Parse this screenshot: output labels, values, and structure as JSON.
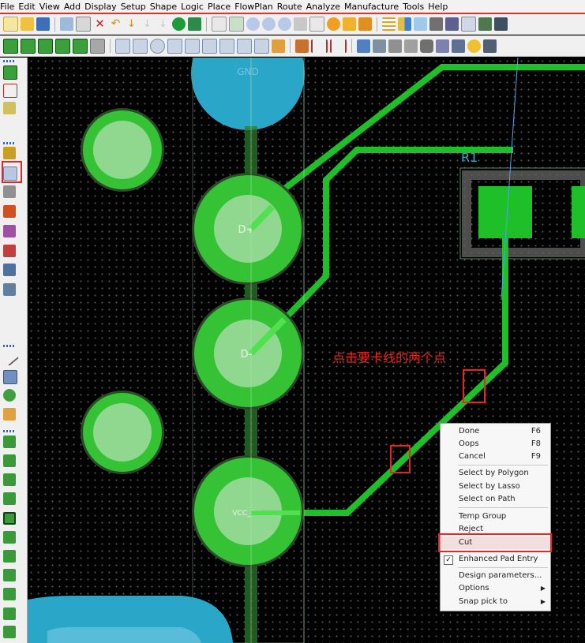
{
  "menu": [
    "File",
    "Edit",
    "View",
    "Add",
    "Display",
    "Setup",
    "Shape",
    "Logic",
    "Place",
    "FlowPlan",
    "Route",
    "Analyze",
    "Manufacture",
    "Tools",
    "Help"
  ],
  "canvas": {
    "pad_labels": {
      "gnd": "GND",
      "dplus": "D+",
      "dminus": "D-",
      "vcc": "VCC_5V"
    },
    "component_ref": "R1",
    "trace_labels": [
      "D+",
      "D-",
      "VCC_5V"
    ]
  },
  "annotation": "点击要卡线的两个点",
  "context_menu": {
    "groups": [
      [
        {
          "label": "Done",
          "shortcut": "F6"
        },
        {
          "label": "Oops",
          "shortcut": "F8"
        },
        {
          "label": "Cancel",
          "shortcut": "F9"
        }
      ],
      [
        {
          "label": "Select by Polygon"
        },
        {
          "label": "Select by Lasso"
        },
        {
          "label": "Select on Path"
        }
      ],
      [
        {
          "label": "Temp Group"
        },
        {
          "label": "Reject"
        },
        {
          "label": "Cut"
        }
      ],
      [
        {
          "label": "Enhanced Pad Entry",
          "checked": true
        }
      ],
      [
        {
          "label": "Design parameters..."
        },
        {
          "label": "Options",
          "submenu": true
        },
        {
          "label": "Snap pick to",
          "submenu": true
        }
      ]
    ],
    "highlighted": "Cut"
  },
  "colors": {
    "highlight": "#e8251f",
    "trace": "#1fbf2a",
    "pad": "#35c235",
    "pad_inner": "#90d890",
    "gnd_pad": "#2aa6c8",
    "background": "#000000"
  }
}
